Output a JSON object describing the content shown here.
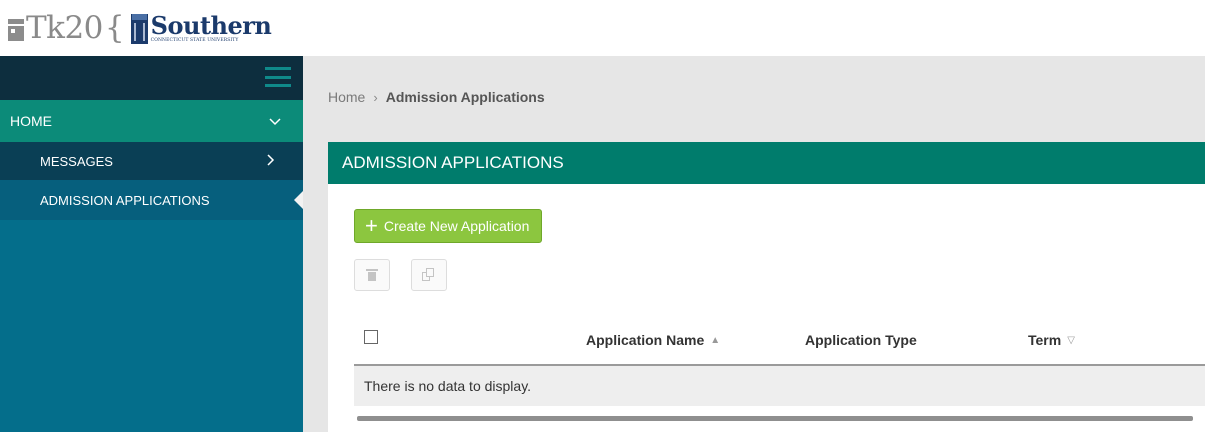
{
  "header": {
    "logo_text": "Tk20",
    "logo_brace": "{",
    "southern_name": "Southern",
    "southern_sub": "CONNECTICUT STATE UNIVERSITY"
  },
  "sidebar": {
    "menu_icon": "hamburger-menu-icon",
    "items": [
      {
        "label": "HOME",
        "icon": "chevron-down-icon"
      },
      {
        "label": "MESSAGES",
        "icon": "chevron-right-icon"
      },
      {
        "label": "ADMISSION APPLICATIONS"
      }
    ]
  },
  "breadcrumb": {
    "home": "Home",
    "separator": "›",
    "current": "Admission Applications"
  },
  "panel": {
    "title": "ADMISSION APPLICATIONS",
    "create_label": "Create New Application",
    "delete_icon": "trash-icon",
    "copy_icon": "copy-icon"
  },
  "table": {
    "columns": [
      {
        "label": "Application Name",
        "sort": "▲"
      },
      {
        "label": "Application Type",
        "sort": ""
      },
      {
        "label": "Term",
        "sort": "▽"
      }
    ],
    "empty_message": "There is no data to display."
  },
  "colors": {
    "sidebar_bg": "#046e8b",
    "home_bg": "#0c8b79",
    "panel_title_bg": "#007c6c",
    "create_button": "#8cc63f"
  }
}
